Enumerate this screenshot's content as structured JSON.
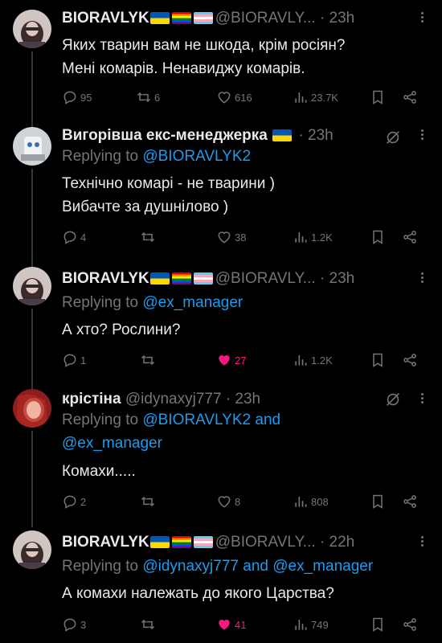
{
  "tweets": [
    {
      "name": "BIORAVLYK",
      "flags": [
        "ua",
        "pride",
        "trans"
      ],
      "handle": "@BIORAVLY...",
      "dot": "·",
      "time": "23h",
      "replying_prefix": "",
      "replying_to": [],
      "text_lines": [
        "Яких тварин вам не шкода, крім росіян?",
        "Мені комарів. Ненавиджу комарів."
      ],
      "replies": "95",
      "retweets": "6",
      "likes": "616",
      "views": "23.7K",
      "liked": false,
      "muted_icon": false
    },
    {
      "name": "Вигорівша екс-менеджерка",
      "flags": [
        "ua"
      ],
      "handle": "",
      "dot": "·",
      "time": "23h",
      "replying_prefix": "Replying to",
      "replying_to": [
        "@BIORAVLYK2"
      ],
      "text_lines": [
        "Технічно комарі - не тварини )",
        "Вибачте за душнілово )"
      ],
      "replies": "4",
      "retweets": "",
      "likes": "38",
      "views": "1.2K",
      "liked": false,
      "muted_icon": true
    },
    {
      "name": "BIORAVLYK",
      "flags": [
        "ua",
        "pride",
        "trans"
      ],
      "handle": "@BIORAVLY...",
      "dot": "·",
      "time": "23h",
      "replying_prefix": "Replying to",
      "replying_to": [
        "@ex_manager"
      ],
      "text_lines": [
        "А хто? Рослини?"
      ],
      "replies": "1",
      "retweets": "",
      "likes": "27",
      "views": "1.2K",
      "liked": true,
      "muted_icon": false
    },
    {
      "name": "крістіна",
      "flags": [],
      "handle": "@idynaxyj777",
      "dot": "·",
      "time": "23h",
      "replying_prefix": "Replying to",
      "replying_to": [
        "@BIORAVLYK2",
        "and",
        "@ex_manager"
      ],
      "text_lines": [
        "Комахи....."
      ],
      "replies": "2",
      "retweets": "",
      "likes": "8",
      "views": "808",
      "liked": false,
      "muted_icon": true
    },
    {
      "name": "BIORAVLYK",
      "flags": [
        "ua",
        "pride",
        "trans"
      ],
      "handle": "@BIORAVLY...",
      "dot": "·",
      "time": "22h",
      "replying_prefix": "Replying to",
      "replying_to": [
        "@idynaxyj777",
        "and",
        "@ex_manager"
      ],
      "text_lines": [
        "А комахи належать до якого Царства?"
      ],
      "replies": "3",
      "retweets": "",
      "likes": "41",
      "views": "749",
      "liked": true,
      "muted_icon": false
    }
  ],
  "colors": {
    "background": "#000000",
    "text": "#e7e9ea",
    "secondary": "#71767b",
    "link": "#1d9bf0",
    "like": "#f91880",
    "thread_line": "#333639"
  },
  "icons": [
    "reply-icon",
    "retweet-icon",
    "like-icon",
    "views-icon",
    "bookmark-icon",
    "share-icon",
    "more-icon",
    "mute-icon"
  ]
}
